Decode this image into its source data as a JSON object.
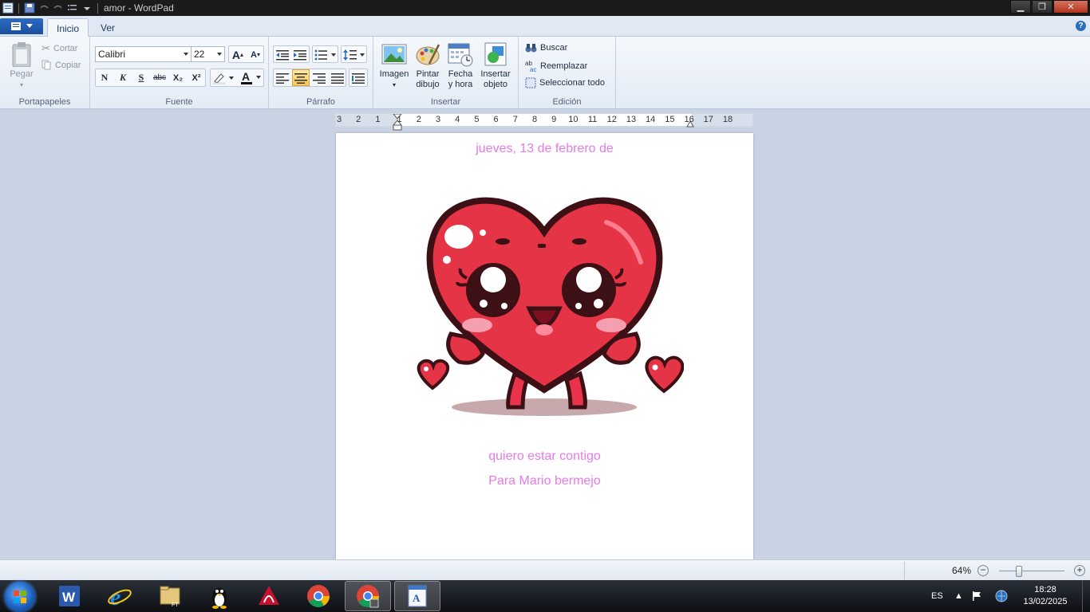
{
  "window": {
    "title": "amor - WordPad"
  },
  "ribbon": {
    "tabs": [
      {
        "label": "Inicio",
        "active": true
      },
      {
        "label": "Ver",
        "active": false
      }
    ],
    "groups": {
      "portapapeles": {
        "label": "Portapapeles",
        "paste": "Pegar",
        "cut": "Cortar",
        "copy": "Copiar"
      },
      "fuente": {
        "label": "Fuente",
        "font_family": "Calibri",
        "font_size": "22",
        "bold": "N",
        "italic": "K",
        "underline": "S",
        "strike": "abc",
        "subscript": "X₂",
        "superscript": "X²"
      },
      "parrafo": {
        "label": "Párrafo",
        "alignment": "center"
      },
      "insertar": {
        "label": "Insertar",
        "image": "Imagen",
        "paint_line1": "Pintar",
        "paint_line2": "dibujo",
        "date_line1": "Fecha",
        "date_line2": "y hora",
        "object_line1": "Insertar",
        "object_line2": "objeto"
      },
      "edicion": {
        "label": "Edición",
        "find": "Buscar",
        "replace": "Reemplazar",
        "select_all": "Seleccionar todo"
      }
    }
  },
  "ruler": {
    "ticks": [
      "3",
      "2",
      "1",
      "1",
      "2",
      "3",
      "4",
      "5",
      "6",
      "7",
      "8",
      "9",
      "10",
      "11",
      "12",
      "13",
      "14",
      "15",
      "16",
      "17",
      "18"
    ]
  },
  "document": {
    "date_line": "jueves, 13 de febrero de",
    "line1": "quiero estar contigo",
    "line2": "Para Mario bermejo",
    "text_color": "#e879e8",
    "image": "cartoon-heart-character"
  },
  "statusbar": {
    "zoom": "64%",
    "zoom_minus": "−",
    "zoom_plus": "+"
  },
  "taskbar": {
    "apps": [
      "word",
      "internet-explorer",
      "folder",
      "tux",
      "acrobat",
      "chrome",
      "chrome-active",
      "wordpad"
    ],
    "language": "ES",
    "time": "18:28",
    "date": "13/02/2025"
  }
}
